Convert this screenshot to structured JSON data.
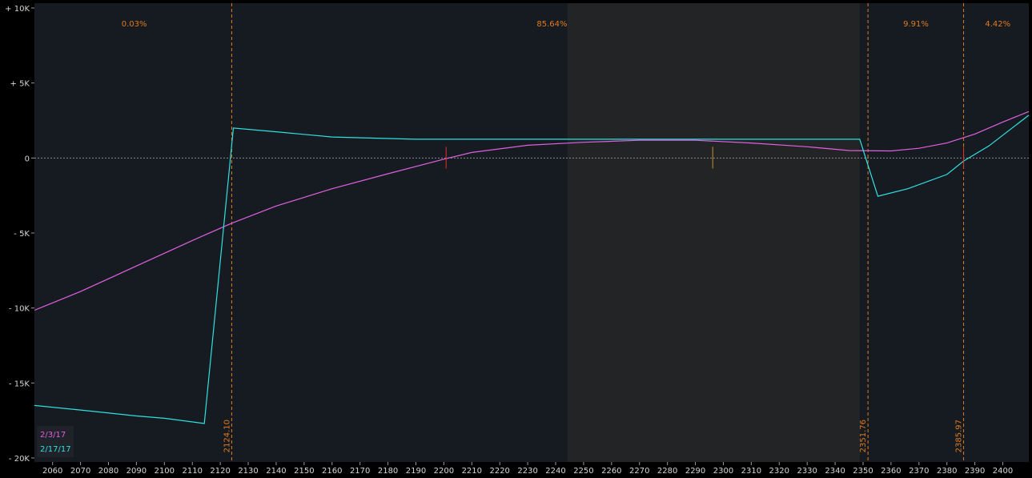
{
  "chart_data": {
    "type": "line",
    "y_ticks": [
      {
        "value": 10000,
        "label": "+ 10K"
      },
      {
        "value": 5000,
        "label": "+ 5K"
      },
      {
        "value": 0,
        "label": "0"
      },
      {
        "value": -5000,
        "label": "- 5K"
      },
      {
        "value": -10000,
        "label": "- 10K"
      },
      {
        "value": -15000,
        "label": "- 15K"
      },
      {
        "value": -20000,
        "label": "- 20K"
      }
    ],
    "x_ticks": [
      2060,
      2070,
      2080,
      2090,
      2100,
      2110,
      2120,
      2130,
      2140,
      2150,
      2160,
      2170,
      2180,
      2190,
      2200,
      2210,
      2220,
      2230,
      2240,
      2250,
      2260,
      2270,
      2280,
      2290,
      2300,
      2310,
      2320,
      2330,
      2340,
      2350,
      2360,
      2370,
      2380,
      2390,
      2400
    ],
    "xlim": [
      2053.5,
      2409.3
    ],
    "ylim": [
      -20000,
      10000
    ],
    "zero_line": true,
    "shaded_range": [
      2244.2,
      2348.8
    ],
    "probability_labels": [
      {
        "x": 2089.2,
        "text": "0.03%"
      },
      {
        "x": 2238.7,
        "text": "85.64%"
      },
      {
        "x": 2368.9,
        "text": "9.91%"
      },
      {
        "x": 2398.2,
        "text": "4.42%"
      }
    ],
    "breakevens": [
      {
        "value": 2124.1,
        "label": "2124.10"
      },
      {
        "value": 2351.76,
        "label": "2351.76"
      },
      {
        "value": 2385.97,
        "label": "2385.97"
      }
    ],
    "markers": [
      {
        "x": 2200.8,
        "color": "#e0302a"
      },
      {
        "x": 2296.2,
        "color": "#c8902a"
      },
      {
        "x": 2385.97,
        "color": "#e0302a"
      }
    ],
    "series": [
      {
        "name": "2/3/17",
        "color": "#e060e0",
        "points": [
          [
            2053.5,
            -10150
          ],
          [
            2070,
            -8900
          ],
          [
            2090,
            -7200
          ],
          [
            2110,
            -5500
          ],
          [
            2124.1,
            -4350
          ],
          [
            2140,
            -3200
          ],
          [
            2160,
            -2050
          ],
          [
            2180,
            -1050
          ],
          [
            2200,
            -80
          ],
          [
            2210,
            370
          ],
          [
            2230,
            850
          ],
          [
            2250,
            1050
          ],
          [
            2270,
            1180
          ],
          [
            2290,
            1180
          ],
          [
            2310,
            1000
          ],
          [
            2330,
            750
          ],
          [
            2345,
            500
          ],
          [
            2360,
            470
          ],
          [
            2370,
            650
          ],
          [
            2380,
            1000
          ],
          [
            2390,
            1600
          ],
          [
            2400,
            2400
          ],
          [
            2409.3,
            3100
          ]
        ]
      },
      {
        "name": "2/17/17",
        "color": "#30e0e0",
        "points": [
          [
            2053.5,
            -16500
          ],
          [
            2070,
            -16800
          ],
          [
            2090,
            -17200
          ],
          [
            2100,
            -17350
          ],
          [
            2114.3,
            -17700
          ],
          [
            2124.7,
            2000
          ],
          [
            2140,
            1750
          ],
          [
            2160,
            1400
          ],
          [
            2190,
            1250
          ],
          [
            2240,
            1250
          ],
          [
            2300,
            1250
          ],
          [
            2348.8,
            1250
          ],
          [
            2355.3,
            -2550
          ],
          [
            2366,
            -2050
          ],
          [
            2380,
            -1100
          ],
          [
            2385.97,
            -200
          ],
          [
            2395,
            800
          ],
          [
            2409.3,
            2850
          ]
        ]
      }
    ]
  }
}
